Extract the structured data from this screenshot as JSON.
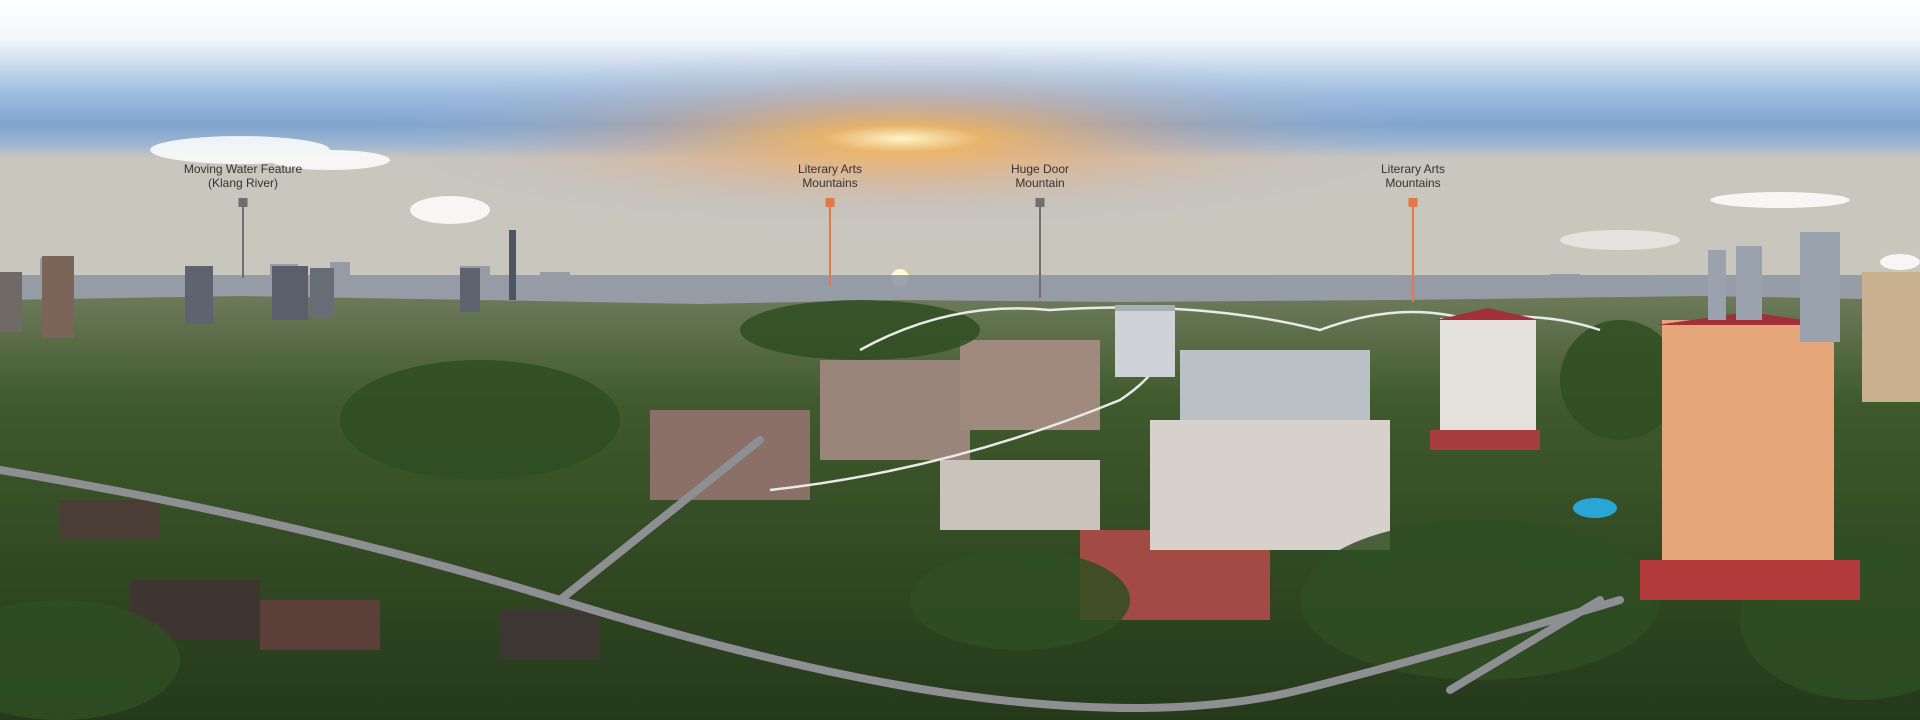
{
  "markers": [
    {
      "line1": "Moving Water Feature",
      "line2": "(Klang River)",
      "color": "#6f6f6f"
    },
    {
      "line1": "Literary Arts",
      "line2": "Mountains",
      "color": "#e07a4a"
    },
    {
      "line1": "Huge Door",
      "line2": "Mountain",
      "color": "#6f6f6f"
    },
    {
      "line1": "Literary Arts",
      "line2": "Mountains",
      "color": "#e07a4a"
    }
  ],
  "colors": {
    "sky_top": "#ffffff",
    "sky_mid": "#7fa4cf",
    "sun_glow": "#f5b45a",
    "trail": "#e9e9e9"
  }
}
